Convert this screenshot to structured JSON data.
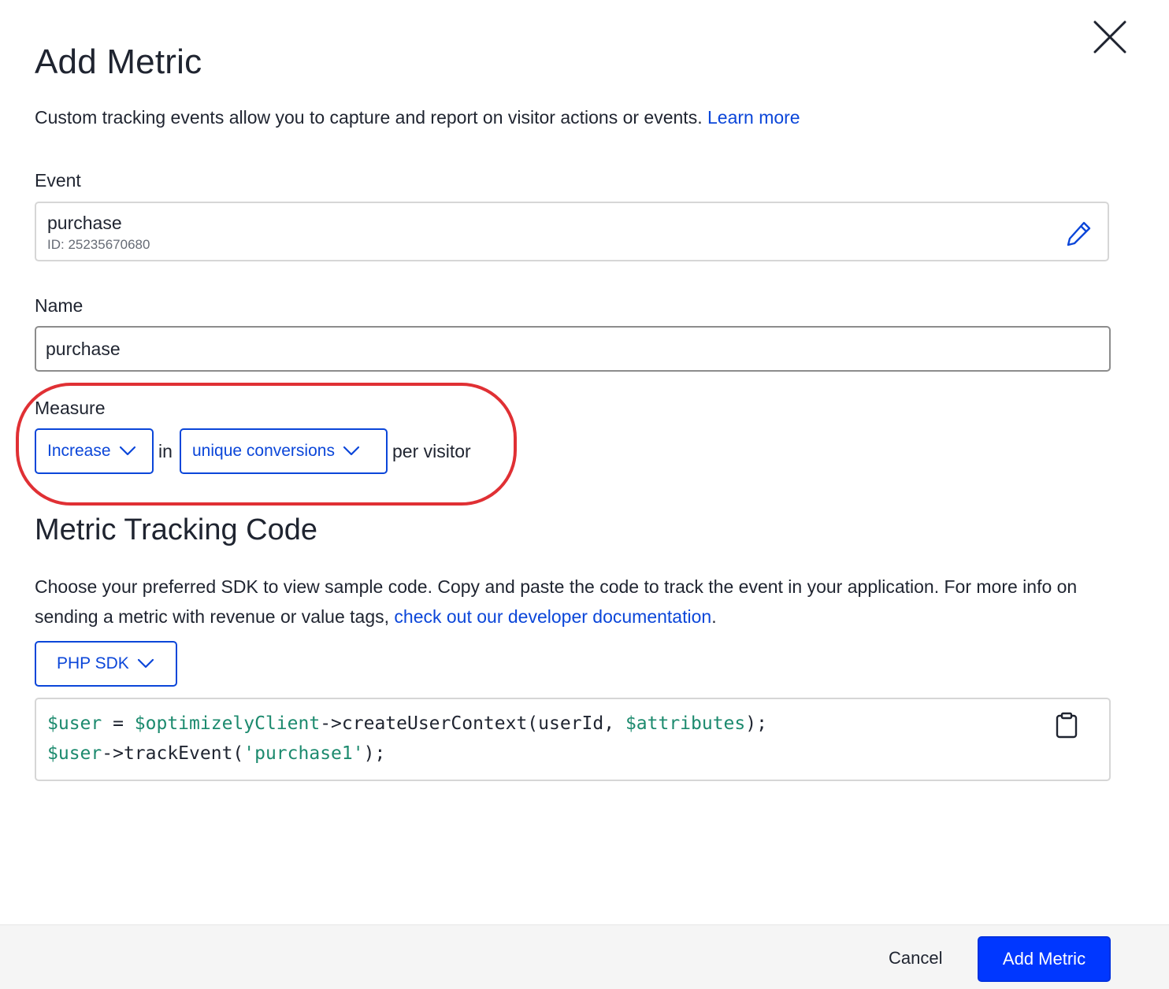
{
  "dialog": {
    "title": "Add Metric",
    "intro_text": "Custom tracking events allow you to capture and report on visitor actions or events.",
    "learn_more_label": "Learn more"
  },
  "event": {
    "label": "Event",
    "name": "purchase",
    "id_text": "ID: 25235670680"
  },
  "name_field": {
    "label": "Name",
    "value": "purchase"
  },
  "measure": {
    "label": "Measure",
    "direction_selected": "Increase",
    "connector_text": "in",
    "metric_selected": "unique conversions",
    "suffix_text": "per visitor"
  },
  "tracking": {
    "title": "Metric Tracking Code",
    "description": "Choose your preferred SDK to view sample code. Copy and paste the code to track the event in your application. For more info on sending a metric with revenue or value tags,",
    "doc_link_label": "check out our developer documentation",
    "doc_link_suffix": ".",
    "sdk_selected": "PHP SDK",
    "code_line_1": {
      "var1": "$user",
      "op": " = ",
      "var2": "$optimizelyClient",
      "call": "->createUserContext(userId, ",
      "var3": "$attributes",
      "end": ");"
    },
    "code_line_2": {
      "var1": "$user",
      "call": "->trackEvent(",
      "str": "'purchase1'",
      "end": ");"
    }
  },
  "footer": {
    "cancel_label": "Cancel",
    "submit_label": "Add Metric"
  },
  "colors": {
    "accent": "#0b46d9",
    "primary_button": "#0037ff",
    "highlight_annotation": "#e03034",
    "code_variable": "#1c8a6e"
  },
  "icons": {
    "close": "close-icon",
    "edit": "pencil-icon",
    "dropdown": "chevron-down-icon",
    "copy": "clipboard-icon"
  }
}
